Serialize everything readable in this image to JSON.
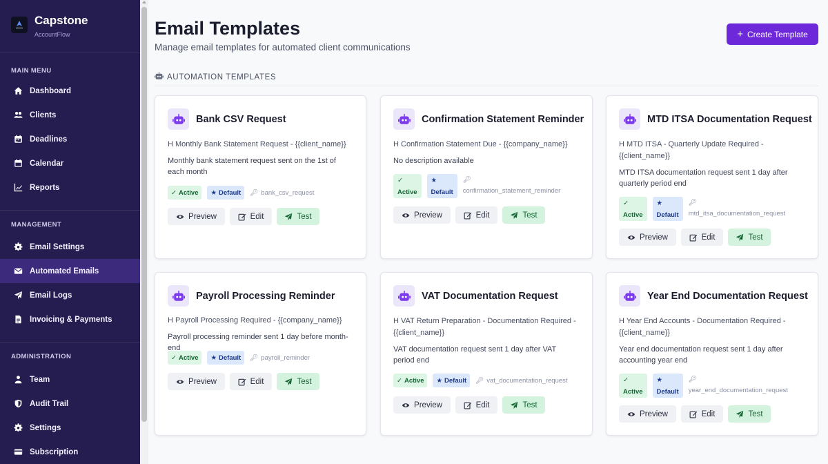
{
  "brand": {
    "name": "Capstone",
    "sub": "AccountFlow"
  },
  "sidebar": {
    "main_menu_label": "MAIN MENU",
    "main": [
      {
        "label": "Dashboard",
        "icon": "home-icon"
      },
      {
        "label": "Clients",
        "icon": "users-icon"
      },
      {
        "label": "Deadlines",
        "icon": "calendar-check-icon"
      },
      {
        "label": "Calendar",
        "icon": "calendar-icon"
      },
      {
        "label": "Reports",
        "icon": "chart-icon"
      }
    ],
    "management_label": "MANAGEMENT",
    "management": [
      {
        "label": "Email Settings",
        "icon": "gear-icon"
      },
      {
        "label": "Automated Emails",
        "icon": "envelope-icon"
      },
      {
        "label": "Email Logs",
        "icon": "paper-plane-icon"
      },
      {
        "label": "Invoicing & Payments",
        "icon": "invoice-icon"
      }
    ],
    "administration_label": "ADMINISTRATION",
    "administration": [
      {
        "label": "Team",
        "icon": "user-icon"
      },
      {
        "label": "Audit Trail",
        "icon": "shield-icon"
      },
      {
        "label": "Settings",
        "icon": "gear-icon"
      },
      {
        "label": "Subscription",
        "icon": "card-icon"
      }
    ]
  },
  "header": {
    "title": "Email Templates",
    "subtitle": "Manage email templates for automated client communications",
    "create_label": "Create Template"
  },
  "section": {
    "label": "AUTOMATION TEMPLATES"
  },
  "labels": {
    "active": "Active",
    "default": "Default",
    "preview": "Preview",
    "edit": "Edit",
    "test": "Test"
  },
  "templates": [
    {
      "title": "Bank CSV Request",
      "subject": "Monthly Bank Statement Request - {{client_name}}",
      "description": "Monthly bank statement request sent on the 1st of each month",
      "key": "bank_csv_request"
    },
    {
      "title": "Confirmation Statement Reminder",
      "subject": "Confirmation Statement Due - {{company_name}}",
      "description": "No description available",
      "key": "confirmation_statement_reminder"
    },
    {
      "title": "MTD ITSA Documentation Request",
      "subject": "MTD ITSA - Quarterly Update Required - {{client_name}}",
      "description": "MTD ITSA documentation request sent 1 day after quarterly period end",
      "key": "mtd_itsa_documentation_request"
    },
    {
      "title": "Payroll Processing Reminder",
      "subject": "Payroll Processing Required - {{company_name}}",
      "description": "Payroll processing reminder sent 1 day before month-end",
      "key": "payroll_reminder"
    },
    {
      "title": "VAT Documentation Request",
      "subject": "VAT Return Preparation - Documentation Required - {{client_name}}",
      "description": "VAT documentation request sent 1 day after VAT period end",
      "key": "vat_documentation_request"
    },
    {
      "title": "Year End Documentation Request",
      "subject": "Year End Accounts - Documentation Required - {{client_name}}",
      "description": "Year end documentation request sent 1 day after accounting year end",
      "key": "year_end_documentation_request"
    }
  ],
  "colors": {
    "sidebar": "#251c4f",
    "active_nav": "#3c2b7d",
    "accent": "#6d28d9"
  }
}
